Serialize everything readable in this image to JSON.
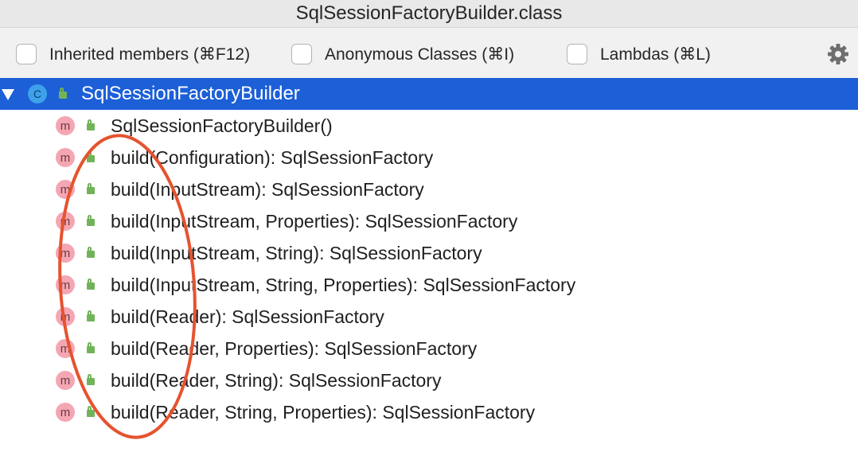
{
  "window": {
    "title": "SqlSessionFactoryBuilder.class"
  },
  "toolbar": {
    "options": [
      {
        "label": "Inherited members (⌘F12)",
        "checked": false
      },
      {
        "label": "Anonymous Classes (⌘I)",
        "checked": false
      },
      {
        "label": "Lambdas (⌘L)",
        "checked": false
      }
    ],
    "settings_icon": "gear-icon"
  },
  "tree": {
    "class_node": {
      "name": "SqlSessionFactoryBuilder",
      "icon_letter": "C",
      "icon": "class-icon",
      "expanded": true,
      "selected": true
    },
    "members": [
      {
        "icon_letter": "m",
        "signature": "SqlSessionFactoryBuilder()"
      },
      {
        "icon_letter": "m",
        "signature": "build(Configuration): SqlSessionFactory"
      },
      {
        "icon_letter": "m",
        "signature": "build(InputStream): SqlSessionFactory"
      },
      {
        "icon_letter": "m",
        "signature": "build(InputStream, Properties): SqlSessionFactory"
      },
      {
        "icon_letter": "m",
        "signature": "build(InputStream, String): SqlSessionFactory"
      },
      {
        "icon_letter": "m",
        "signature": "build(InputStream, String, Properties): SqlSessionFactory"
      },
      {
        "icon_letter": "m",
        "signature": "build(Reader): SqlSessionFactory"
      },
      {
        "icon_letter": "m",
        "signature": "build(Reader, Properties): SqlSessionFactory"
      },
      {
        "icon_letter": "m",
        "signature": "build(Reader, String): SqlSessionFactory"
      },
      {
        "icon_letter": "m",
        "signature": "build(Reader, String, Properties): SqlSessionFactory"
      }
    ]
  },
  "colors": {
    "selection": "#1c5fd7",
    "class_icon": "#3ea1ea",
    "method_icon": "#f4a6b3",
    "lock_icon": "#72b35a",
    "annotation": "#e5532f"
  }
}
